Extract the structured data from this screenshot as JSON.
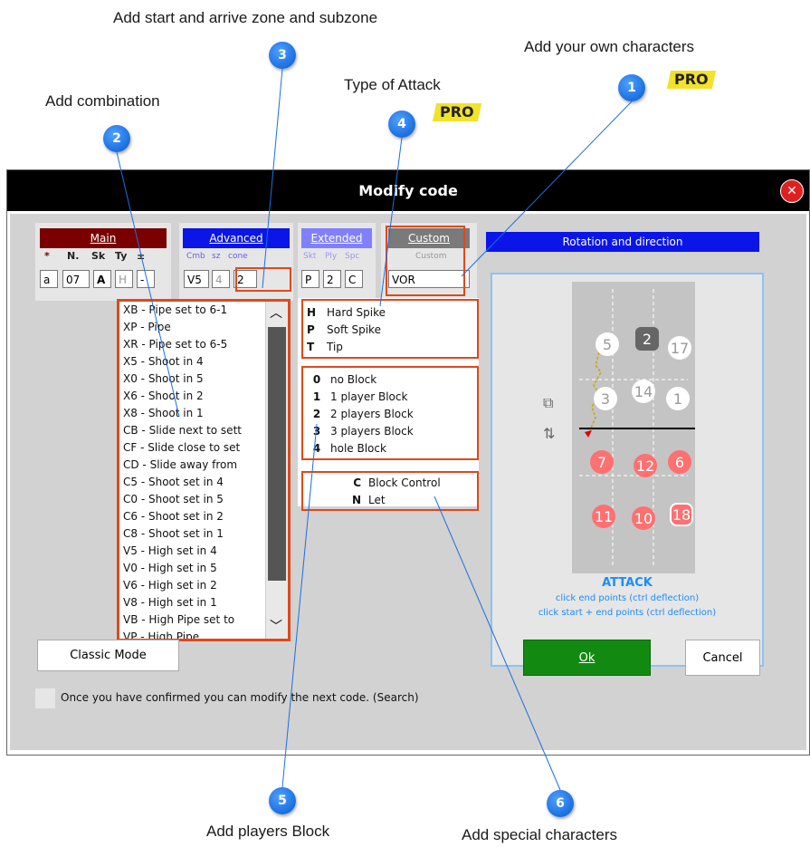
{
  "annotations": {
    "start_arrive": "Add start and arrive zone and subzone",
    "own_chars": "Add your own characters",
    "type_attack": "Type of Attack",
    "combination": "Add combination",
    "players_block": "Add players Block",
    "special_chars": "Add special characters",
    "pro": "PRO",
    "badges": [
      "1",
      "2",
      "3",
      "4",
      "5",
      "6"
    ]
  },
  "dialog": {
    "title": "Modify code",
    "main": {
      "header": "Main",
      "labels": [
        "*",
        "N.",
        "Sk",
        "Ty",
        "±"
      ],
      "values": [
        "a",
        "07",
        "A",
        "H",
        "-"
      ]
    },
    "advanced": {
      "header": "Advanced",
      "labels": [
        "Cmb",
        "sz",
        "cone"
      ],
      "values": [
        "V5",
        "4",
        "2"
      ]
    },
    "extended": {
      "header": "Extended",
      "labels": [
        "Skt",
        "Ply",
        "Spc"
      ],
      "values": [
        "P",
        "2",
        "C"
      ]
    },
    "custom": {
      "header": "Custom",
      "label": "Custom",
      "value": "VOR"
    },
    "combinations": [
      "XB - Pipe set to 6-1",
      "XP - Pipe",
      "XR - Pipe set to 6-5",
      "X5 - Shoot in 4",
      "X0 - Shoot in 5",
      "X6 - Shoot in 2",
      "X8 - Shoot in 1",
      "CB - Slide next to sett",
      "CF - Slide close to set",
      "CD - Slide away from",
      "C5 - Shoot set in 4",
      "C0 - Shoot set in 5",
      "C6 - Shoot set in 2",
      "C8 - Shoot set in 1",
      "V5 - High set in 4",
      "V0 - High set in 5",
      "V6 - High set in 2",
      "V8 - High set in 1",
      "VB - High Pipe set to",
      "VP - High Pipe"
    ],
    "attack_types": [
      {
        "k": "H",
        "v": "Hard Spike"
      },
      {
        "k": "P",
        "v": "Soft Spike"
      },
      {
        "k": "T",
        "v": "Tip"
      }
    ],
    "blocks": [
      {
        "k": "0",
        "v": "no Block"
      },
      {
        "k": "1",
        "v": "1 player Block"
      },
      {
        "k": "2",
        "v": "2 players Block"
      },
      {
        "k": "3",
        "v": "3 players Block"
      },
      {
        "k": "4",
        "v": "hole Block"
      }
    ],
    "specials": [
      {
        "k": "C",
        "v": "Block Control"
      },
      {
        "k": "N",
        "v": "Let"
      }
    ],
    "rotation": {
      "header": "Rotation and direction",
      "top_players": [
        "5",
        "2",
        "17",
        "3",
        "14",
        "1"
      ],
      "bottom_players": [
        "7",
        "12",
        "6",
        "11",
        "10",
        "18"
      ],
      "caption": "ATTACK",
      "hint1": "click end points (ctrl deflection)",
      "hint2": "click start + end points (ctrl deflection)"
    },
    "classic_mode": "Classic Mode",
    "ok": "Ok",
    "cancel": "Cancel",
    "confirm_text": "Once you have confirmed you can modify the next code. (Search)"
  }
}
